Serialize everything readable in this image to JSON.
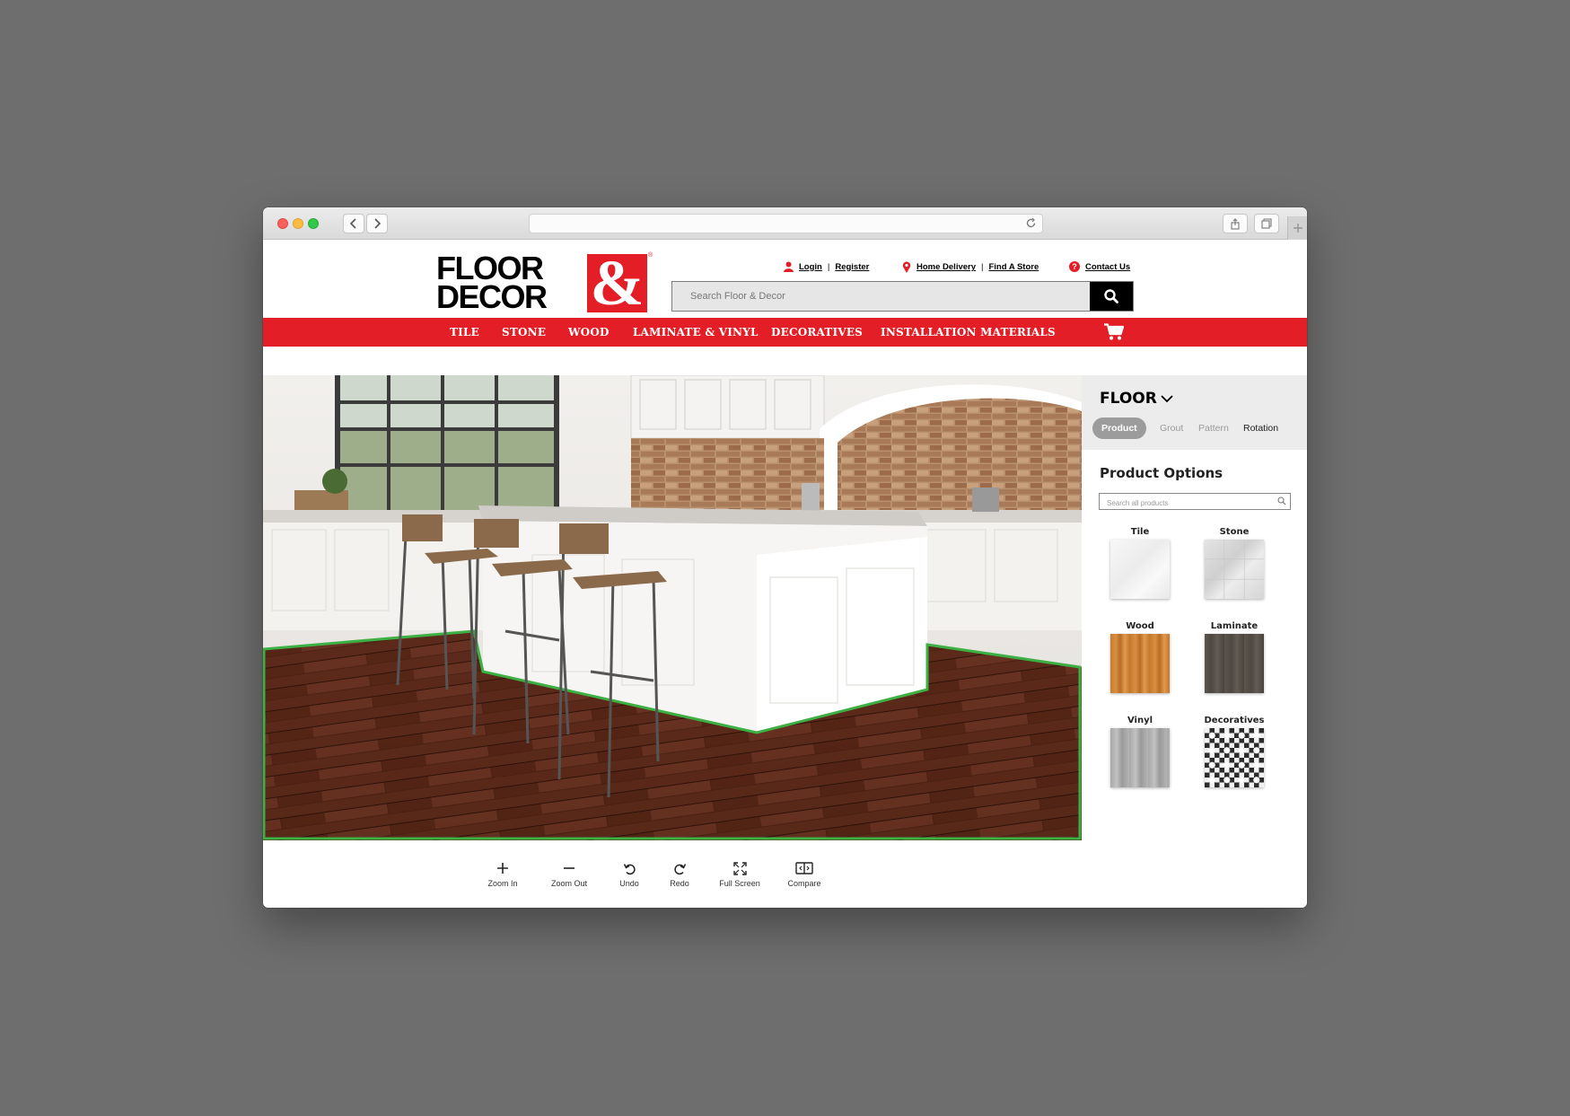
{
  "header": {
    "logo_word_1": "FLOOR",
    "logo_word_2": "DECOR",
    "logo_amp": "&",
    "logo_reg": "®",
    "login": "Login",
    "separator": "|",
    "register": "Register",
    "home_delivery": "Home Delivery",
    "find_store": "Find A Store",
    "contact": "Contact Us",
    "search_placeholder": "Search Floor & Decor"
  },
  "nav": {
    "items": [
      "TILE",
      "STONE",
      "WOOD",
      "LAMINATE & VINYL",
      "DECORATIVES",
      "INSTALLATION MATERIALS"
    ]
  },
  "toolbar": {
    "zoom_in": "Zoom In",
    "zoom_out": "Zoom Out",
    "undo": "Undo",
    "redo": "Redo",
    "full_screen": "Full Screen",
    "compare": "Compare"
  },
  "panel": {
    "surface": "FLOOR",
    "tabs": [
      "Product",
      "Grout",
      "Pattern",
      "Rotation"
    ],
    "active_tab": "Product",
    "options_title": "Product Options",
    "search_placeholder": "Search all products",
    "categories": [
      "Tile",
      "Stone",
      "Wood",
      "Laminate",
      "Vinyl",
      "Decoratives"
    ]
  },
  "colors": {
    "brand_red": "#e41e26",
    "selection_outline": "#3cb043"
  },
  "icons": [
    "search-icon",
    "user-icon",
    "location-pin-icon",
    "help-icon",
    "cart-icon",
    "plus-icon",
    "minus-icon",
    "undo-icon",
    "redo-icon",
    "fullscreen-icon",
    "compare-icon",
    "chevron-down-icon"
  ]
}
